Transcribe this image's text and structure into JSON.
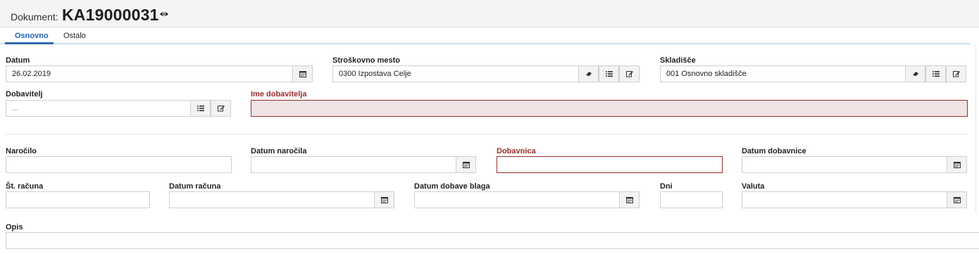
{
  "header": {
    "label": "Dokument:",
    "number": "KA19000031"
  },
  "tabs": [
    {
      "label": "Osnovno",
      "active": true
    },
    {
      "label": "Ostalo",
      "active": false
    }
  ],
  "colors": {
    "accent": "#2f69b5",
    "required": "#9b2c2c",
    "tab_line": "#cfe0f1"
  },
  "icons": {
    "visibility": "eye-icon",
    "date": "calendar-icon",
    "clear": "eraser-icon",
    "select": "list-icon",
    "edit": "edit-icon"
  },
  "form": {
    "datum": {
      "label": "Datum",
      "value": "26.02.2019"
    },
    "stroskovno_mesto": {
      "label": "Stroškovno mesto",
      "value": "0300 Izpostava Celje"
    },
    "skladisce": {
      "label": "Skladišče",
      "value": "001 Osnovno skladišče"
    },
    "dobavitelj": {
      "label": "Dobavitelj",
      "value": "..."
    },
    "ime_dobavitelja": {
      "label": "Ime dobavitelja",
      "value": ""
    },
    "narocilo": {
      "label": "Naročilo",
      "value": ""
    },
    "datum_narocila": {
      "label": "Datum naročila",
      "value": ""
    },
    "dobavnica": {
      "label": "Dobavnica",
      "value": ""
    },
    "datum_dobavnice": {
      "label": "Datum dobavnice",
      "value": ""
    },
    "st_racuna": {
      "label": "Št. računa",
      "value": ""
    },
    "datum_racuna": {
      "label": "Datum računa",
      "value": ""
    },
    "datum_dobave_blaga": {
      "label": "Datum dobave blaga",
      "value": ""
    },
    "dni": {
      "label": "Dni",
      "value": ""
    },
    "valuta": {
      "label": "Valuta",
      "value": ""
    },
    "opis": {
      "label": "Opis",
      "value": ""
    }
  }
}
